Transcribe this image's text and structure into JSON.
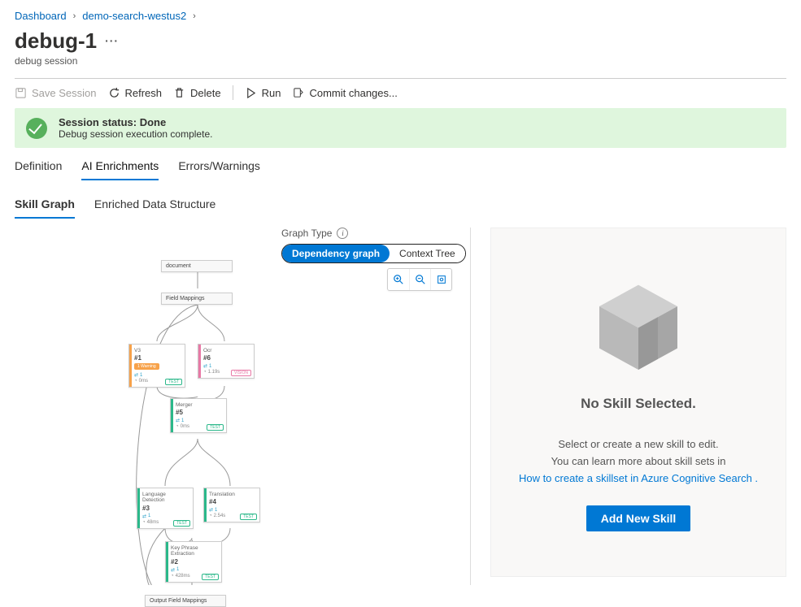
{
  "breadcrumbs": {
    "items": [
      "Dashboard",
      "demo-search-westus2"
    ]
  },
  "header": {
    "title": "debug-1",
    "subtitle": "debug session"
  },
  "toolbar": {
    "save": "Save Session",
    "refresh": "Refresh",
    "delete": "Delete",
    "run": "Run",
    "commit": "Commit changes..."
  },
  "banner": {
    "title": "Session status: Done",
    "desc": "Debug session execution complete."
  },
  "tabs": {
    "items": [
      "Definition",
      "AI Enrichments",
      "Errors/Warnings"
    ],
    "activeIndex": 1
  },
  "subtabs": {
    "items": [
      "Skill Graph",
      "Enriched Data Structure"
    ],
    "activeIndex": 0
  },
  "graphControls": {
    "label": "Graph Type",
    "options": [
      "Dependency graph",
      "Context Tree"
    ],
    "activeIndex": 0
  },
  "graph": {
    "nodes": {
      "document": "document",
      "fieldMappings": "Field Mappings",
      "outputFieldMappings": "Output Field Mappings",
      "s1": {
        "name": "V3",
        "num": "#1",
        "warn": "1 Warning",
        "input": "1",
        "time": "0ms",
        "tag": "TEST",
        "accent": "#f7a24a"
      },
      "s2": {
        "name": "Ocr",
        "num": "#6",
        "input": "1",
        "time": "1.19s",
        "tag": "VISION",
        "accent": "#e879a6"
      },
      "s3": {
        "name": "Merger",
        "num": "#5",
        "input": "1",
        "time": "0ms",
        "tag": "TEST",
        "accent": "#2bb88a"
      },
      "s4": {
        "name": "Language Detection",
        "num": "#3",
        "input": "1",
        "time": "48ms",
        "tag": "TEST",
        "accent": "#2bb88a"
      },
      "s5": {
        "name": "Translation",
        "num": "#4",
        "input": "1",
        "time": "2.54s",
        "tag": "TEST",
        "accent": "#2bb88a"
      },
      "s6": {
        "name": "Key Phrase Extraction",
        "num": "#2",
        "input": "1",
        "time": "428ms",
        "tag": "TEST",
        "accent": "#2bb88a"
      }
    }
  },
  "rightPanel": {
    "heading": "No Skill Selected.",
    "line1": "Select or create a new skill to edit.",
    "line2": "You can learn more about skill sets in",
    "link": "How to create a skillset in Azure Cognitive Search .",
    "button": "Add New Skill"
  }
}
